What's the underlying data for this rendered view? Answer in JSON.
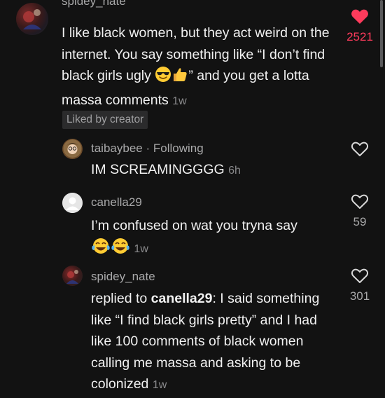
{
  "comments": [
    {
      "username": "spidey_nate",
      "text": "I like black women, but they act weird on the internet. You say something like “I don’t find black girls ugly",
      "text_after_emoji": "” and you get a lotta massa comments",
      "time": "1w",
      "likes": "2521",
      "liked": true,
      "liked_by_creator": "Liked by creator"
    }
  ],
  "replies": [
    {
      "username": "taibaybee",
      "following": "Following",
      "separator": "·",
      "text": "IM SCREAMINGGGG",
      "time": "6h",
      "likes": ""
    },
    {
      "username": "canella29",
      "text": "I’m confused on wat you tryna say",
      "time": "1w",
      "likes": "59"
    },
    {
      "username": "spidey_nate",
      "reply_prefix": "replied to ",
      "reply_to": "canella29",
      "text": ": I said something like “I find black girls pretty” and I had like 100 comments of black women calling me massa and asking to be colonized",
      "time": "1w",
      "likes": "301"
    }
  ],
  "icons": {
    "liked_heart": "heart-filled-icon",
    "heart": "heart-outline-icon",
    "sunglasses": "smiling-face-with-sunglasses-emoji",
    "thumbs_up": "thumbs-up-emoji",
    "laughing": "face-with-tears-of-joy-emoji"
  },
  "colors": {
    "background": "#121212",
    "liked_red": "#ff3b5c",
    "secondary_text": "#a9a9aa"
  }
}
